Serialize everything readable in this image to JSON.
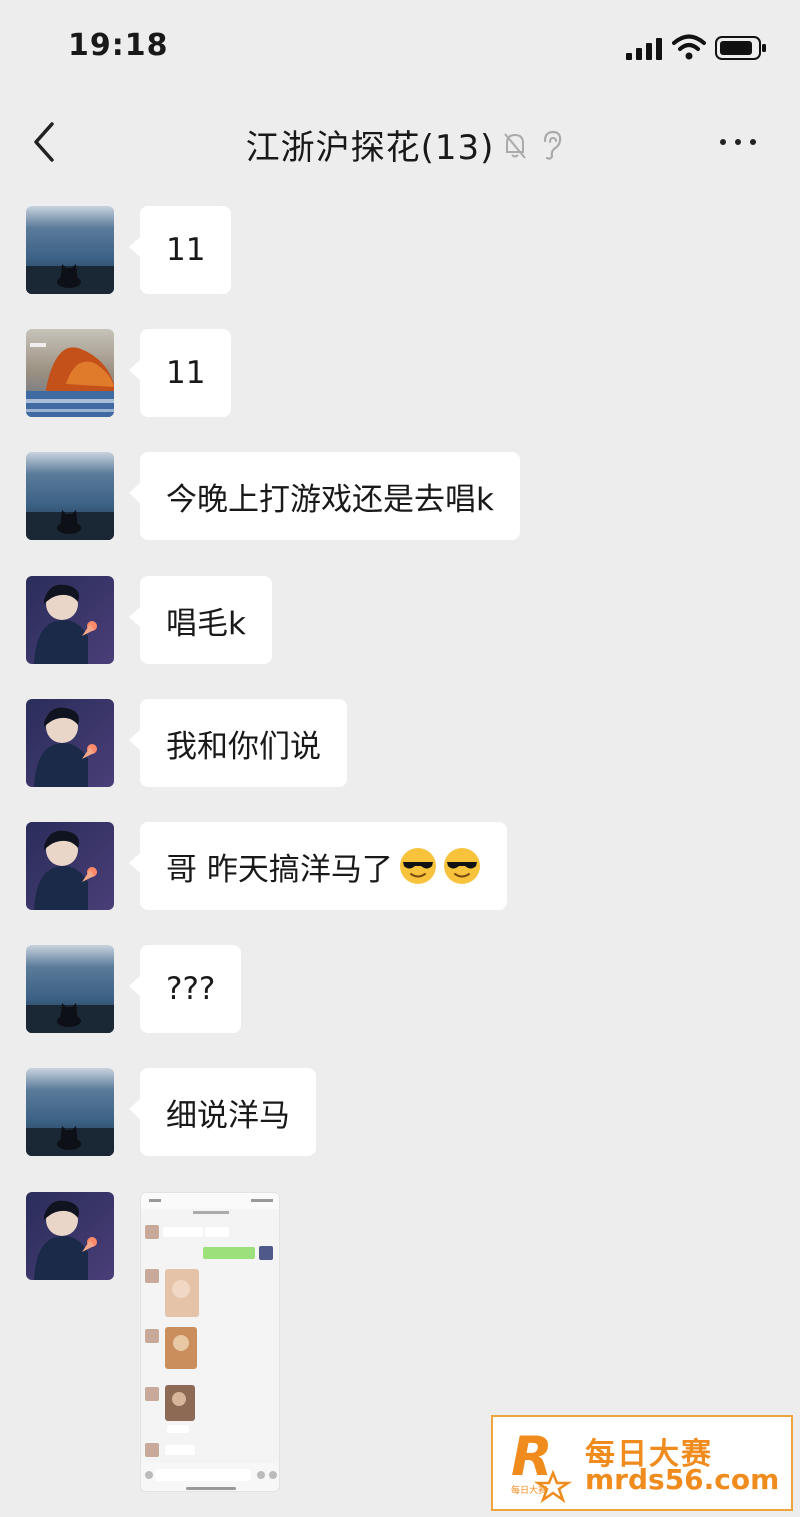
{
  "status_bar": {
    "time": "19:18"
  },
  "nav": {
    "title": "江浙沪探花(13)"
  },
  "messages": [
    {
      "avatar": "cat-avatar",
      "text": "11"
    },
    {
      "avatar": "autumn-avatar",
      "text": "11"
    },
    {
      "avatar": "cat-avatar",
      "text": "今晚上打游戏还是去唱k"
    },
    {
      "avatar": "anime-avatar",
      "text": "唱毛k"
    },
    {
      "avatar": "anime-avatar",
      "text": "我和你们说"
    },
    {
      "avatar": "anime-avatar",
      "text": "哥 昨天搞洋马了",
      "emojis": [
        "sunglasses-emoji",
        "sunglasses-emoji"
      ]
    },
    {
      "avatar": "cat-avatar",
      "text": "???"
    },
    {
      "avatar": "cat-avatar",
      "text": "细说洋马"
    },
    {
      "avatar": "anime-avatar",
      "image": "chat-screenshot-image"
    }
  ],
  "watermark": {
    "name": "每日大赛",
    "url": "mrds56.com",
    "logo_letter": "R",
    "logo_caption": "每日大赛"
  },
  "colors": {
    "background": "#ededed",
    "bubble": "#ffffff",
    "watermark": "#f08c1e"
  }
}
